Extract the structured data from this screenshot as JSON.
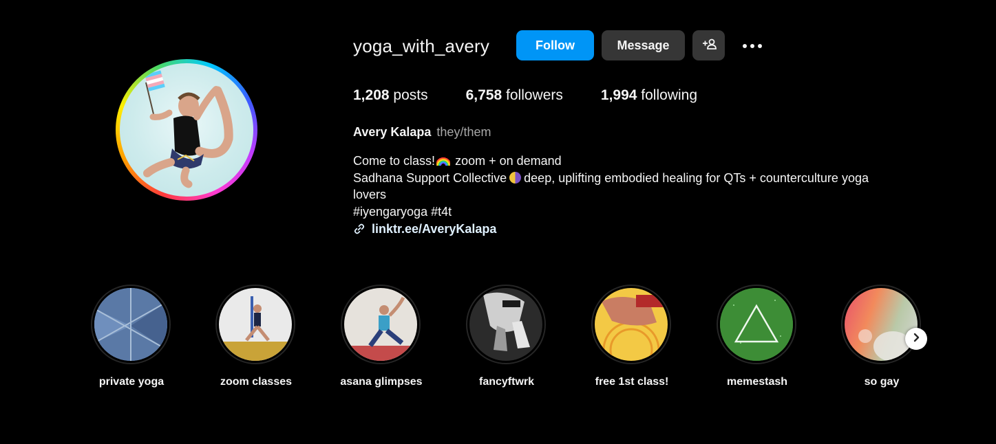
{
  "profile": {
    "username": "yoga_with_avery",
    "follow_label": "Follow",
    "message_label": "Message",
    "add_user_icon": "add-user-icon",
    "more_icon": "more-options-icon"
  },
  "stats": {
    "posts_count": "1,208",
    "posts_label": "posts",
    "followers_count": "6,758",
    "followers_label": "followers",
    "following_count": "1,994",
    "following_label": "following"
  },
  "bio": {
    "full_name": "Avery Kalapa",
    "pronouns": "they/them",
    "line1_a": "Come to class!",
    "line1_b": "zoom + on demand",
    "line2_a": "Sadhana Support Collective",
    "line2_b": "deep, uplifting embodied healing for QTs + counterculture yoga",
    "line3": "lovers",
    "line4": "#iyengaryoga #t4t",
    "link": "linktr.ee/AveryKalapa"
  },
  "highlights": [
    {
      "label": "private yoga"
    },
    {
      "label": "zoom classes"
    },
    {
      "label": "asana glimpses"
    },
    {
      "label": "fancyftwrk"
    },
    {
      "label": "free 1st class!"
    },
    {
      "label": "memestash"
    },
    {
      "label": "so gay"
    }
  ],
  "colors": {
    "follow_button": "#0095f6",
    "secondary_button": "#363636",
    "background": "#000000",
    "muted_text": "#a8a8a8"
  }
}
